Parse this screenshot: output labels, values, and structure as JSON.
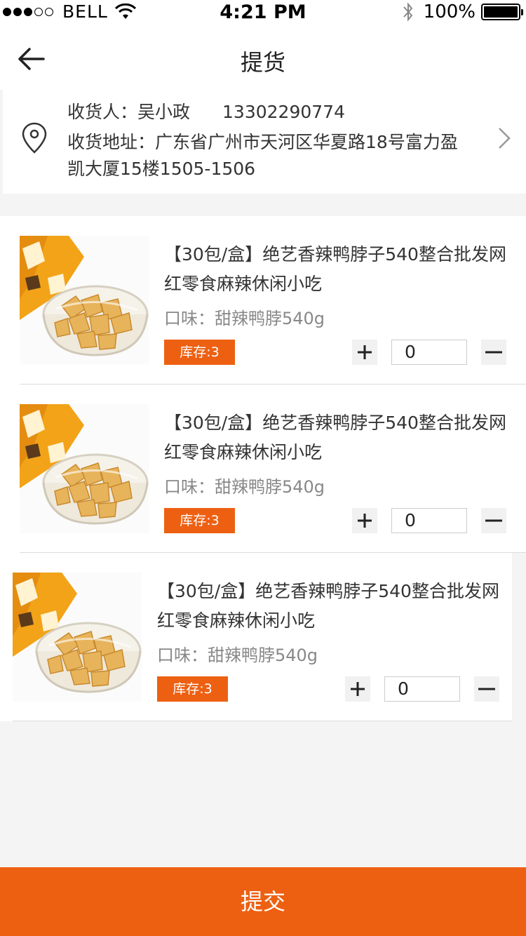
{
  "status_bar": {
    "carrier": "BELL",
    "time": "4:21 PM",
    "battery": "100%",
    "signal_bars_filled": 3,
    "signal_bars_total": 5
  },
  "nav": {
    "title": "提货",
    "back_icon": "arrow-left-icon"
  },
  "address": {
    "receiver_label": "收货人：",
    "receiver_name": "吴小政",
    "phone": "13302290774",
    "address_label": "收货地址：",
    "address_text": "广东省广州市天河区华夏路18号富力盈凯大厦15楼1505-1506",
    "icon": "location-pin-icon",
    "chevron_icon": "chevron-right-icon"
  },
  "products": [
    {
      "title": "【30包/盒】绝艺香辣鸭脖子540整合批发网红零食麻辣休闲小吃",
      "flavor": "口味：甜辣鸭脖540g",
      "stock": "库存:3",
      "quantity": "0"
    },
    {
      "title": "【30包/盒】绝艺香辣鸭脖子540整合批发网红零食麻辣休闲小吃",
      "flavor": "口味：甜辣鸭脖540g",
      "stock": "库存:3",
      "quantity": "0"
    },
    {
      "title": "【30包/盒】绝艺香辣鸭脖子540整合批发网红零食麻辣休闲小吃",
      "flavor": "口味：甜辣鸭脖540g",
      "stock": "库存:3",
      "quantity": "0"
    }
  ],
  "submit_label": "提交",
  "colors": {
    "accent": "#ed6012",
    "background": "#f4f4f4"
  }
}
